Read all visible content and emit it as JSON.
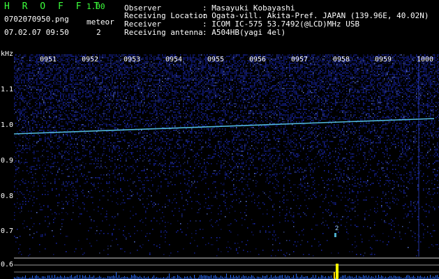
{
  "header": {
    "app_title": "H R O F F T",
    "version": "1.00",
    "filename": "0702070950.png",
    "datetime": "07.02.07 09:50",
    "meteor_label": "meteor",
    "meteor_count": "2"
  },
  "info": [
    {
      "label": "Observer",
      "value": ": Masayuki Kobayashi"
    },
    {
      "label": "Receiving Location",
      "value": ": Ogata-vill. Akita-Pref. JAPAN (139.96E, 40.02N)"
    },
    {
      "label": "Receiver",
      "value": ": ICOM IC-575 53.7492(@LCD)MHz USB"
    },
    {
      "label": "Receiving antenna",
      "value": ": A504HB(yagi 4el)"
    }
  ],
  "yaxis": {
    "unit": "kHz",
    "ticks": [
      "1.1",
      "1.0",
      "0.9",
      "0.8",
      "0.7",
      "0.6"
    ]
  },
  "time_labels": [
    "0951",
    "0952",
    "0953",
    "0954",
    "0955",
    "0956",
    "0957",
    "0958",
    "0959",
    "1000"
  ],
  "colors": {
    "background": "#000000",
    "noise": "#1e2fd0",
    "signal": "#5fd8ff",
    "title": "#3cff3c",
    "meteor_peak": "#ffff00"
  }
}
